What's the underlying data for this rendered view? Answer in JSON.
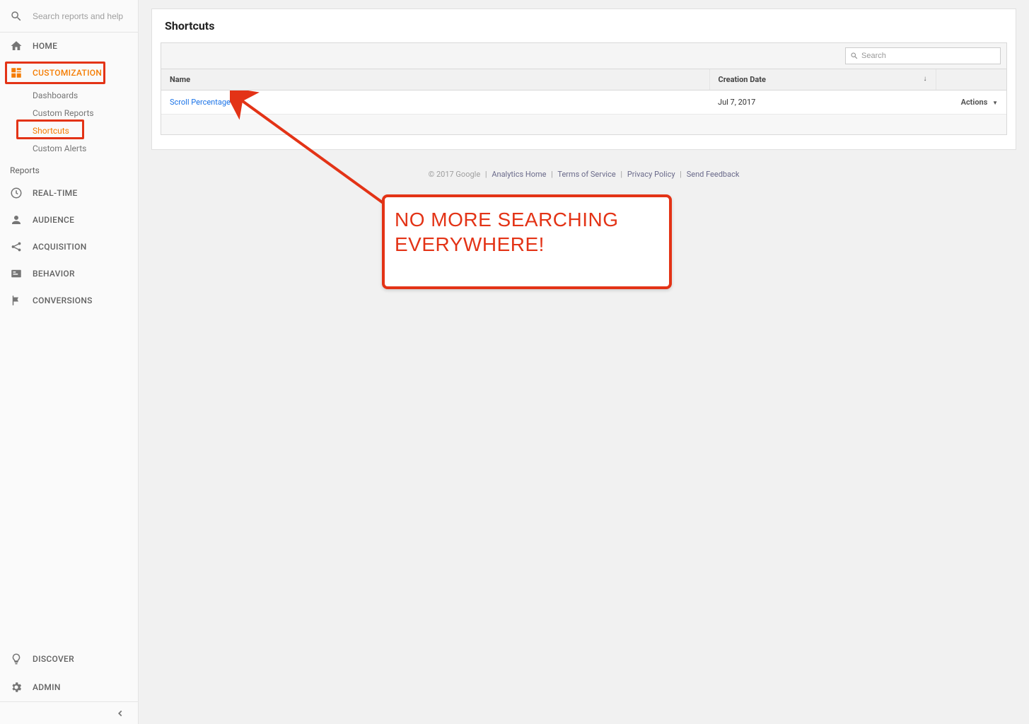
{
  "sidebar": {
    "search_placeholder": "Search reports and help",
    "home": "HOME",
    "customization": "CUSTOMIZATION",
    "customization_items": {
      "dashboards": "Dashboards",
      "custom_reports": "Custom Reports",
      "shortcuts": "Shortcuts",
      "custom_alerts": "Custom Alerts"
    },
    "reports_label": "Reports",
    "realtime": "REAL-TIME",
    "audience": "AUDIENCE",
    "acquisition": "ACQUISITION",
    "behavior": "BEHAVIOR",
    "conversions": "CONVERSIONS",
    "discover": "DISCOVER",
    "admin": "ADMIN"
  },
  "main": {
    "title": "Shortcuts",
    "search_placeholder": "Search",
    "headers": {
      "name": "Name",
      "creation_date": "Creation Date"
    },
    "row": {
      "name": "Scroll Percentage",
      "date": "Jul 7, 2017",
      "actions_label": "Actions"
    }
  },
  "footer": {
    "copyright": "© 2017 Google",
    "analytics_home": "Analytics Home",
    "terms": "Terms of Service",
    "privacy": "Privacy Policy",
    "feedback": "Send Feedback"
  },
  "annotation": {
    "text": "NO MORE SEARCHING EVERYWHERE!"
  }
}
